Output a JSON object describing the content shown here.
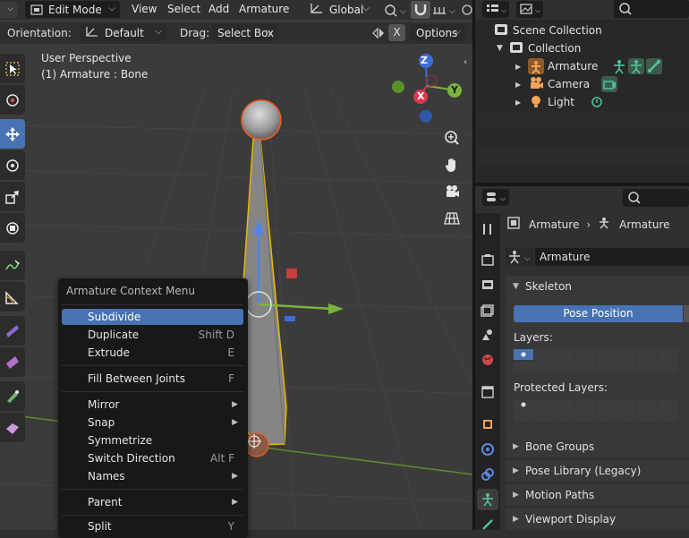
{
  "header": {
    "mode_label": "Edit Mode",
    "menus": [
      "View",
      "Select",
      "Add",
      "Armature"
    ],
    "transform_orientation": "Global"
  },
  "tool_header": {
    "orientation_label": "Orientation:",
    "orientation_value": "Default",
    "drag_label": "Drag:",
    "drag_value": "Select Box",
    "x_label": "X",
    "options_label": "Options"
  },
  "viewport": {
    "perspective_label": "User Perspective",
    "object_label": "(1) Armature : Bone",
    "gizmo": {
      "z": "Z",
      "y": "Y",
      "x": "X"
    },
    "colors": {
      "bone_outline": "#e6b800",
      "bone_fill": "#8a8a8a",
      "x_axis": "#c73c3c",
      "y_axis": "#6fa33a",
      "z_axis": "#3d6dd6",
      "selection": "#f05a1e"
    }
  },
  "context_menu": {
    "title": "Armature Context Menu",
    "items": [
      {
        "label": "Subdivide",
        "shortcut": "",
        "submenu": false
      },
      {
        "label": "Duplicate",
        "shortcut": "Shift D",
        "submenu": false
      },
      {
        "label": "Extrude",
        "shortcut": "E",
        "submenu": false
      },
      {
        "label": "Fill Between Joints",
        "shortcut": "F",
        "submenu": false
      },
      {
        "label": "Mirror",
        "shortcut": "",
        "submenu": true
      },
      {
        "label": "Snap",
        "shortcut": "",
        "submenu": true
      },
      {
        "label": "Symmetrize",
        "shortcut": "",
        "submenu": false
      },
      {
        "label": "Switch Direction",
        "shortcut": "Alt F",
        "submenu": false
      },
      {
        "label": "Names",
        "shortcut": "",
        "submenu": true
      },
      {
        "label": "Parent",
        "shortcut": "",
        "submenu": true
      },
      {
        "label": "Split",
        "shortcut": "Y",
        "submenu": false
      }
    ]
  },
  "outliner": {
    "scene_collection": "Scene Collection",
    "collection": "Collection",
    "objects": [
      "Armature",
      "Camera",
      "Light"
    ]
  },
  "properties": {
    "breadcrumb_object": "Armature",
    "breadcrumb_data": "Armature",
    "datablock_name": "Armature",
    "skeleton_panel": "Skeleton",
    "pose_position_label": "Pose Position",
    "layers_label": "Layers:",
    "protected_layers_label": "Protected Layers:",
    "panels": [
      "Bone Groups",
      "Pose Library (Legacy)",
      "Motion Paths",
      "Viewport Display"
    ]
  },
  "accent_color": "#4772b3"
}
